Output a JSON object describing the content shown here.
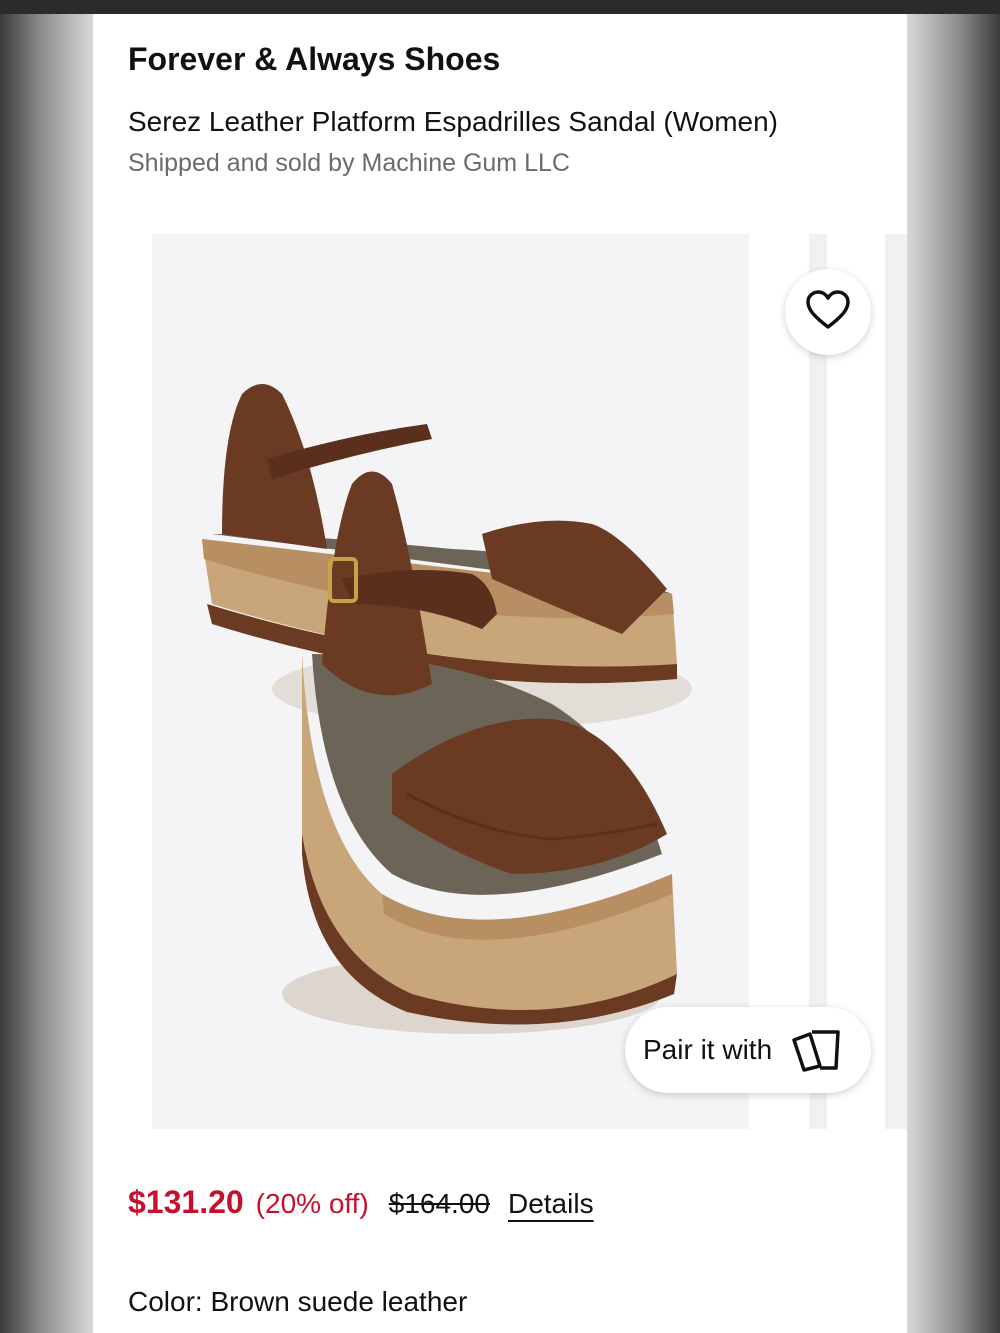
{
  "product": {
    "brand": "Forever & Always Shoes",
    "title": "Serez Leather Platform Espadrilles Sandal (Women)",
    "seller": "Shipped and sold by Machine Gum LLC"
  },
  "gallery": {
    "favorite_icon": "heart-icon",
    "pair_label": "Pair it with",
    "pair_icon": "cards-icon"
  },
  "pricing": {
    "price": "$131.20",
    "discount": "(20% off)",
    "original_price": "$164.00",
    "details_label": "Details"
  },
  "color": {
    "label": "Color: Brown suede leather"
  },
  "colors": {
    "sale_red": "#c8102e",
    "suede_brown": "#6b3a23",
    "jute": "#c9a57a"
  }
}
